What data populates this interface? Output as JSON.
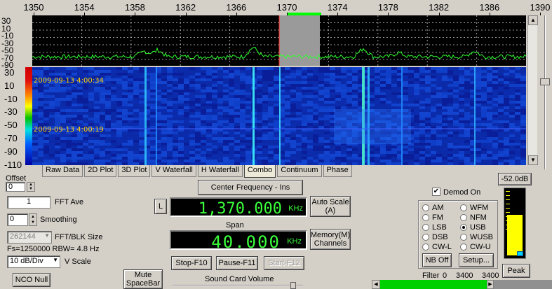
{
  "freq_axis": {
    "ticks": [
      "1350",
      "1354",
      "1358",
      "1362",
      "1366",
      "1370",
      "1374",
      "1378",
      "1382",
      "1386",
      "1390"
    ]
  },
  "spectrum": {
    "db_ticks": [
      "30",
      "10",
      "-10",
      "-30",
      "-50",
      "-70",
      "-90"
    ]
  },
  "waterfall": {
    "db_ticks": [
      "30",
      "10",
      "-10",
      "-30",
      "-50",
      "-70",
      "-90",
      "-110"
    ],
    "timestamps": [
      "2009-09-13 4:00:34",
      "2009-09-13 4:00:19"
    ]
  },
  "tabs": [
    {
      "label": "Raw Data"
    },
    {
      "label": "2D Plot"
    },
    {
      "label": "3D Plot"
    },
    {
      "label": "V Waterfall"
    },
    {
      "label": "H Waterfall"
    },
    {
      "label": "Combo",
      "active": true
    },
    {
      "label": "Continuum"
    },
    {
      "label": "Phase"
    }
  ],
  "controls": {
    "offset_label": "Offset",
    "offset_value": "0",
    "fft_ave_value": "1",
    "fft_ave_label": "FFT Ave",
    "smoothing_value": "0",
    "smoothing_label": "Smoothing",
    "fft_blk_value": "262144",
    "fft_blk_label": "FFT/BLK Size",
    "fs_info": "Fs=1250000 RBW= 4.8 Hz",
    "vscale_value": "10 dB/Div",
    "vscale_label": "V Scale",
    "nco_null": "NCO Null",
    "mute": "Mute SpaceBar"
  },
  "center": {
    "button": "Center Frequency - Ins",
    "l_button": "L",
    "freq_value": "1,370.000",
    "freq_unit": "KHz",
    "auto_scale": "Auto Scale (A)",
    "span_label": "Span",
    "span_value": "40.000",
    "span_unit": "KHz",
    "memory": "Memory(M) Channels",
    "stop": "Stop-F10",
    "pause": "Pause-F11",
    "start": "Start-F12",
    "sound_card": "Sound Card Volume"
  },
  "demod": {
    "demod_on_label": "Demod On",
    "demod_on_checked": true,
    "modes": [
      {
        "label": "AM",
        "checked": false
      },
      {
        "label": "WFM",
        "checked": false
      },
      {
        "label": "FM",
        "checked": false
      },
      {
        "label": "NFM",
        "checked": false
      },
      {
        "label": "LSB",
        "checked": false
      },
      {
        "label": "USB",
        "checked": true
      },
      {
        "label": "DSB",
        "checked": false
      },
      {
        "label": "WUSB",
        "checked": false
      },
      {
        "label": "CW-L",
        "checked": false
      },
      {
        "label": "CW-U",
        "checked": false
      }
    ],
    "nb_off": "NB Off",
    "setup": "Setup...",
    "filter_label": "Filter",
    "filter_lo": "0",
    "filter_hi": "3400",
    "filter_hi2": "3400"
  },
  "meter": {
    "db_value": "-52.0dB",
    "peak": "Peak",
    "level_fraction": 0.62
  },
  "colors": {
    "lcd_green": "#3cff3c",
    "marker_green": "#00ff00"
  }
}
